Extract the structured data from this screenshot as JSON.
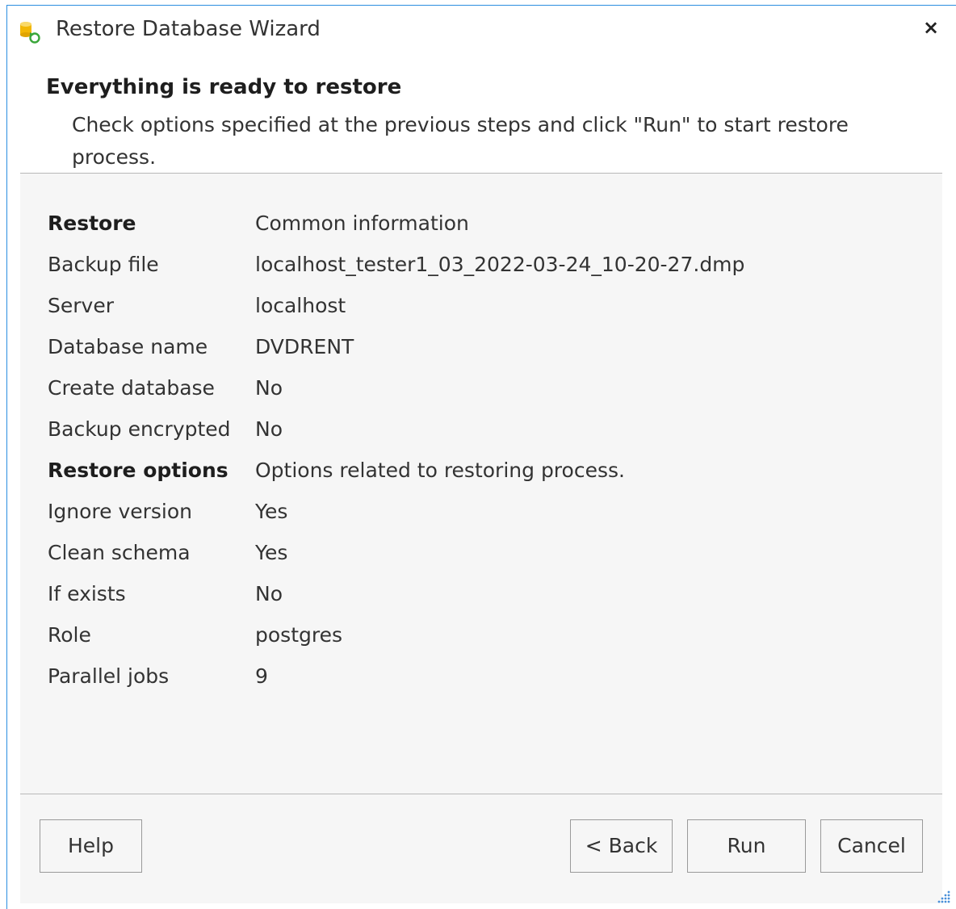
{
  "window": {
    "title": "Restore Database Wizard",
    "close_label": "×",
    "app_icon": "database-restore-icon"
  },
  "header": {
    "heading": "Everything is ready to restore",
    "subheading": "Check options specified at the previous steps and click \"Run\" to start restore process."
  },
  "summary": {
    "rows": [
      {
        "label": "Restore",
        "value": "Common information",
        "section": true
      },
      {
        "label": "Backup file",
        "value": "localhost_tester1_03_2022-03-24_10-20-27.dmp"
      },
      {
        "label": "Server",
        "value": "localhost"
      },
      {
        "label": "Database name",
        "value": "DVDRENT"
      },
      {
        "label": "Create database",
        "value": "No"
      },
      {
        "label": "Backup encrypted",
        "value": "No"
      },
      {
        "label": "Restore options",
        "value": "Options related to restoring process.",
        "section": true
      },
      {
        "label": "Ignore version",
        "value": "Yes"
      },
      {
        "label": "Clean schema",
        "value": "Yes"
      },
      {
        "label": "If exists",
        "value": "No"
      },
      {
        "label": "Role",
        "value": "postgres"
      },
      {
        "label": "Parallel jobs",
        "value": "9"
      }
    ]
  },
  "buttons": {
    "help": "Help",
    "back": "< Back",
    "run": "Run",
    "cancel": "Cancel"
  },
  "colors": {
    "window_border": "#2b8ee0",
    "content_bg": "#f6f6f6",
    "icon_yellow": "#f2b705",
    "icon_green": "#3aa63a"
  }
}
